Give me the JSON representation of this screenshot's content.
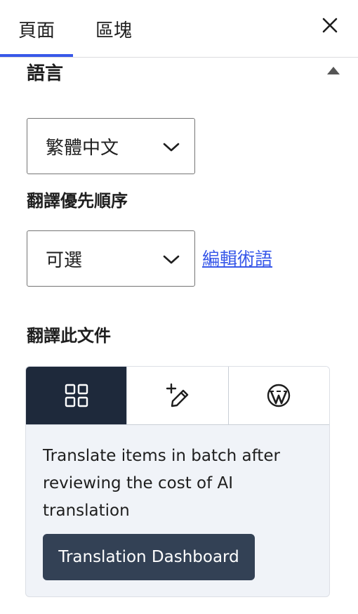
{
  "tabs": {
    "page_label": "頁面",
    "block_label": "區塊",
    "active": "page"
  },
  "close_icon": "close-icon",
  "language_section": {
    "title": "語言",
    "collapse_icon": "triangle-up-icon",
    "language_select": {
      "value": "繁體中文",
      "icon": "chevron-down-icon"
    }
  },
  "priority": {
    "label": "翻譯優先順序",
    "select": {
      "value": "可選",
      "icon": "chevron-down-icon"
    },
    "edit_link": "編輯術語"
  },
  "translate_doc": {
    "label": "翻譯此文件",
    "modes": [
      {
        "icon": "grid-icon",
        "active": true
      },
      {
        "icon": "add-edit-pencil-icon",
        "active": false
      },
      {
        "icon": "wordpress-icon",
        "active": false
      }
    ],
    "description": "Translate items in batch after reviewing the cost of AI translation",
    "button_label": "Translation Dashboard"
  },
  "colors": {
    "accent": "#3858e9",
    "dark_tab": "#1e293b",
    "button_bg": "#334155",
    "card_bg": "#f0f3f8"
  }
}
